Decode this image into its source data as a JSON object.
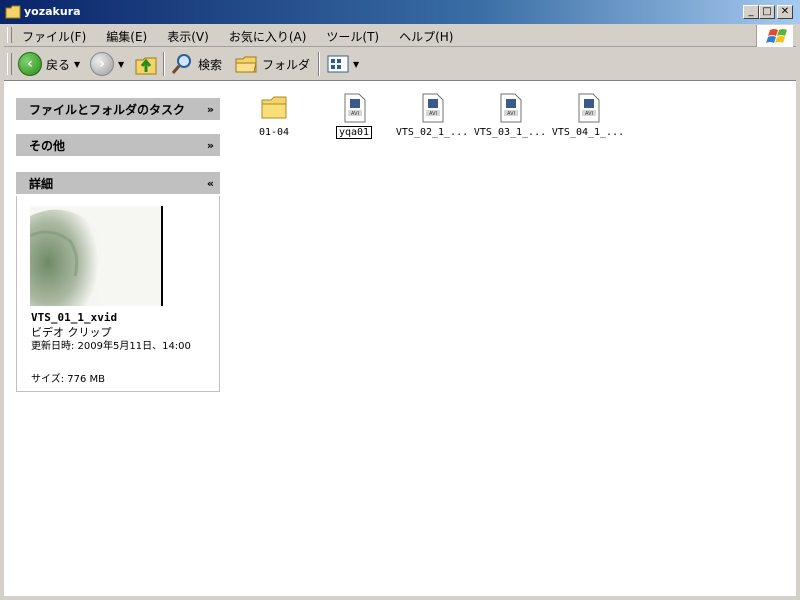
{
  "window": {
    "title": "yozakura",
    "min_label": "_",
    "max_label": "□",
    "close_label": "✕"
  },
  "menu": {
    "items": [
      "ファイル(F)",
      "編集(E)",
      "表示(V)",
      "お気に入り(A)",
      "ツール(T)",
      "ヘルプ(H)"
    ]
  },
  "toolbar": {
    "back_label": "戻る",
    "search_label": "検索",
    "folder_label": "フォルダ"
  },
  "taskpane": {
    "file_folder_tasks": "ファイルとフォルダのタスク",
    "other": "その他",
    "details": "詳細",
    "detail_name": "VTS_01_1_xvid",
    "detail_type": "ビデオ クリップ",
    "detail_modified": "更新日時: 2009年5月11日、14:00",
    "detail_size": "サイズ: 776 MB"
  },
  "files": [
    {
      "name": "01-04",
      "type": "folder"
    },
    {
      "name": "yqa01",
      "type": "avi"
    },
    {
      "name": "VTS_02_1_...",
      "type": "avi"
    },
    {
      "name": "VTS_03_1_...",
      "type": "avi"
    },
    {
      "name": "VTS_04_1_...",
      "type": "avi"
    }
  ],
  "icon_text": {
    "avi": "AVI"
  },
  "colors": {
    "titlebar_start": "#0a246a",
    "titlebar_end": "#a6caf0",
    "chrome": "#d4d0c8",
    "panel_header": "#c0c0c0"
  }
}
